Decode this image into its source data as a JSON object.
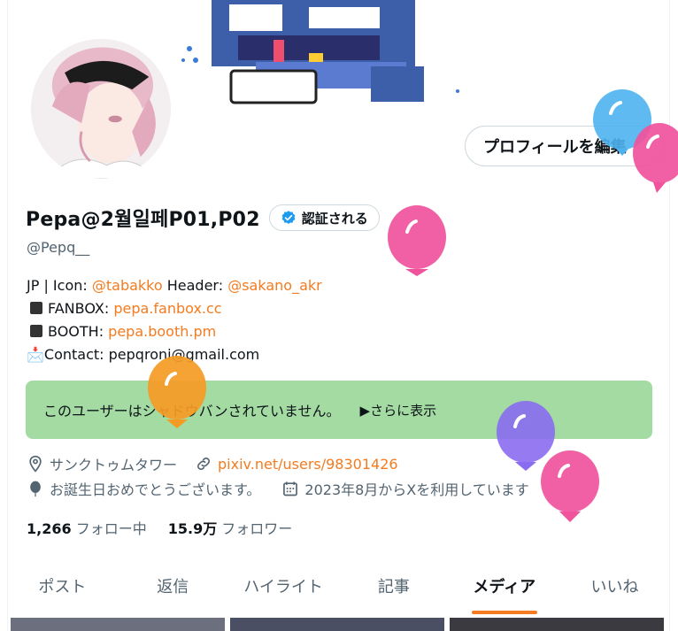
{
  "profile": {
    "edit_label": "プロフィールを編集",
    "display_name": "Pepa@2월일페P01,P02",
    "verified_label": "認証される",
    "handle": "@Pepq__"
  },
  "bio": {
    "line1_prefix": "JP | Icon: ",
    "icon_link": "@tabakko",
    "header_prefix": " Header: ",
    "header_link": "@sakano_akr",
    "fanbox_label": "FANBOX: ",
    "fanbox_link": "pepa.fanbox.cc",
    "booth_label": "BOOTH: ",
    "booth_link": "pepa.booth.pm",
    "contact_emoji": "📩",
    "contact": "Contact: pepqroni@gmail.com"
  },
  "shadowban": {
    "message": "このユーザーはシャドウバンされていません。",
    "more": "▶さらに表示"
  },
  "meta": {
    "location": "サンクトゥムタワー",
    "website": "pixiv.net/users/98301426",
    "birthday": "お誕生日おめでとうございます。",
    "joined": "2023年8月からXを利用しています"
  },
  "follow": {
    "following_count": "1,266",
    "following_label": "フォロー中",
    "followers_count": "15.9万",
    "followers_label": "フォロワー"
  },
  "tabs": [
    {
      "label": "ポスト"
    },
    {
      "label": "返信"
    },
    {
      "label": "ハイライト"
    },
    {
      "label": "記事"
    },
    {
      "label": "メディア"
    },
    {
      "label": "いいね"
    }
  ],
  "colors": {
    "accent": "#f47b20",
    "shadowban_bg": "#a3dba2",
    "verified": "#1d9bf0"
  }
}
